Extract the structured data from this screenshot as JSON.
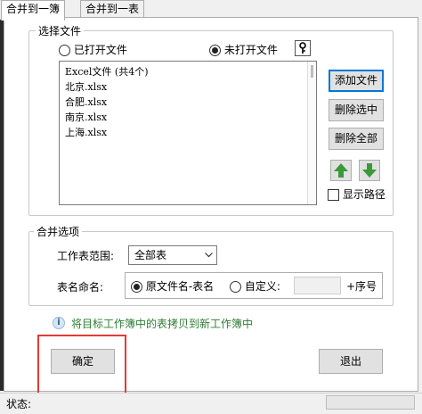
{
  "tabs": [
    "合并到一簿",
    "合并到一表"
  ],
  "select_files": {
    "legend": "选择文件",
    "radio_open": "已打开文件",
    "radio_closed": "未打开文件",
    "list_header": "Excel文件 (共4个)",
    "files": [
      "北京.xlsx",
      "合肥.xlsx",
      "南京.xlsx",
      "上海.xlsx"
    ],
    "add_file": "添加文件",
    "remove_selected": "删除选中",
    "remove_all": "删除全部",
    "show_path": "显示路径"
  },
  "merge_options": {
    "legend": "合并选项",
    "sheet_range_label": "工作表范围:",
    "sheet_range_value": "全部表",
    "sheet_name_label": "表名命名:",
    "naming_option1": "原文件名-表名",
    "naming_option2": "自定义:",
    "suffix": "+序号"
  },
  "info_text": "将目标工作簿中的表拷贝到新工作簿中",
  "ok_button": "确定",
  "exit_button": "退出",
  "status_label": "状态:",
  "colors": {
    "info": "#2e7d32",
    "highlight_box": "#e53935",
    "arrow_green": "#3a9a3a"
  }
}
